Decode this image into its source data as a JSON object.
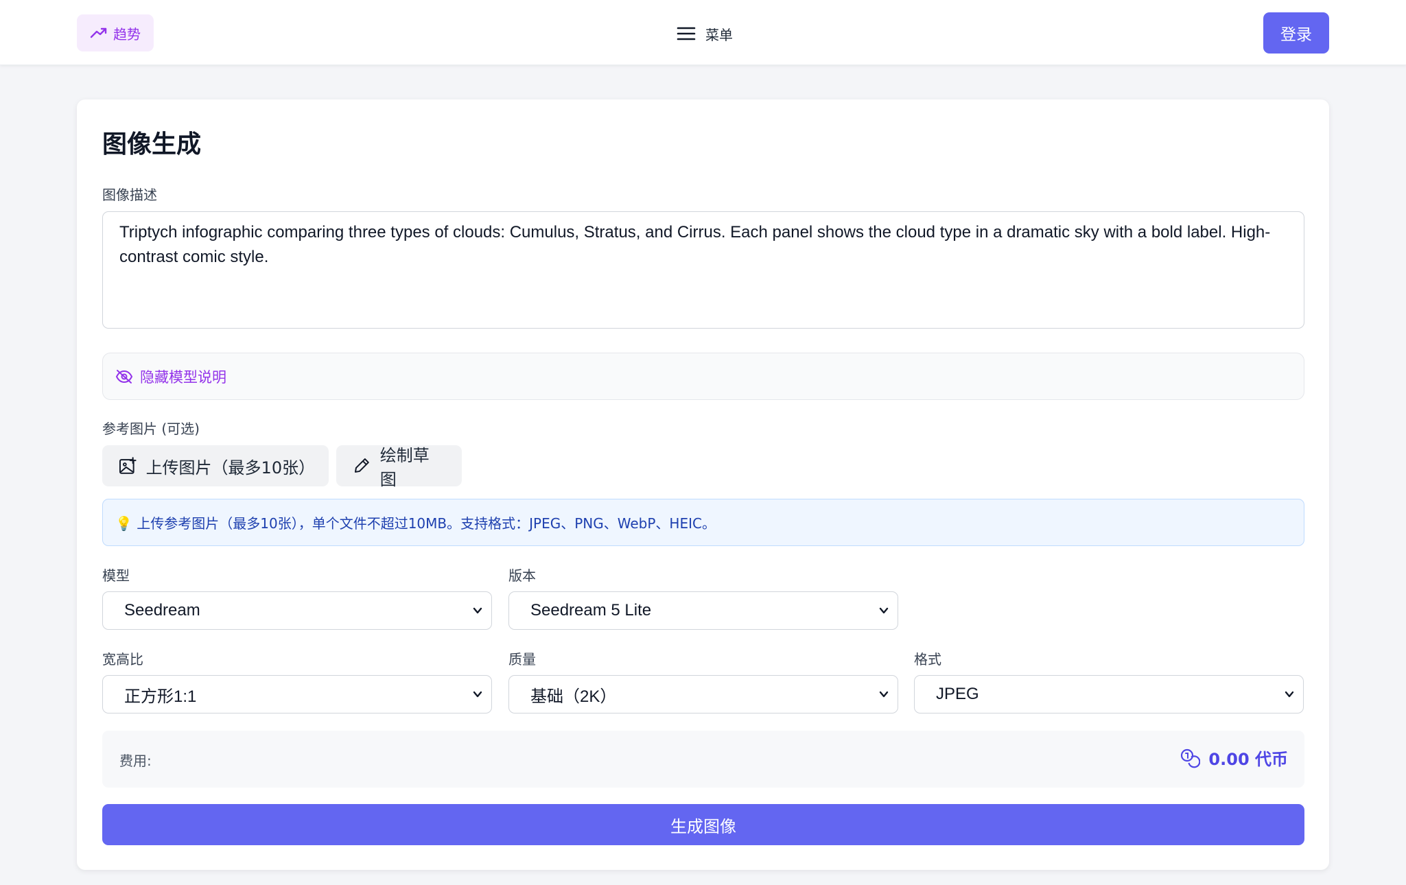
{
  "header": {
    "trend_label": "趋势",
    "menu_label": "菜单",
    "login_label": "登录"
  },
  "main": {
    "title": "图像生成",
    "prompt_label": "图像描述",
    "prompt_value": "Triptych infographic comparing three types of clouds: Cumulus, Stratus, and Cirrus. Each panel shows the cloud type in a dramatic sky with a bold label. High-contrast comic style.",
    "hide_desc_label": "隐藏模型说明",
    "ref_label": "参考图片 (可选)",
    "upload_label": "上传图片（最多10张）",
    "sketch_label": "绘制草图",
    "info_text": "💡 上传参考图片（最多10张），单个文件不超过10MB。支持格式：JPEG、PNG、WebP、HEIC。",
    "model_label": "模型",
    "model_value": "Seedream",
    "version_label": "版本",
    "version_value": "Seedream 5 Lite",
    "ratio_label": "宽高比",
    "ratio_value": "正方形1:1",
    "quality_label": "质量",
    "quality_value": "基础（2K）",
    "format_label": "格式",
    "format_value": "JPEG",
    "cost_label": "费用:",
    "cost_value": "0.00 代币",
    "generate_label": "生成图像"
  },
  "colors": {
    "accent": "#6366f1",
    "purple": "#9333ea",
    "info_bg": "#eff6ff"
  }
}
